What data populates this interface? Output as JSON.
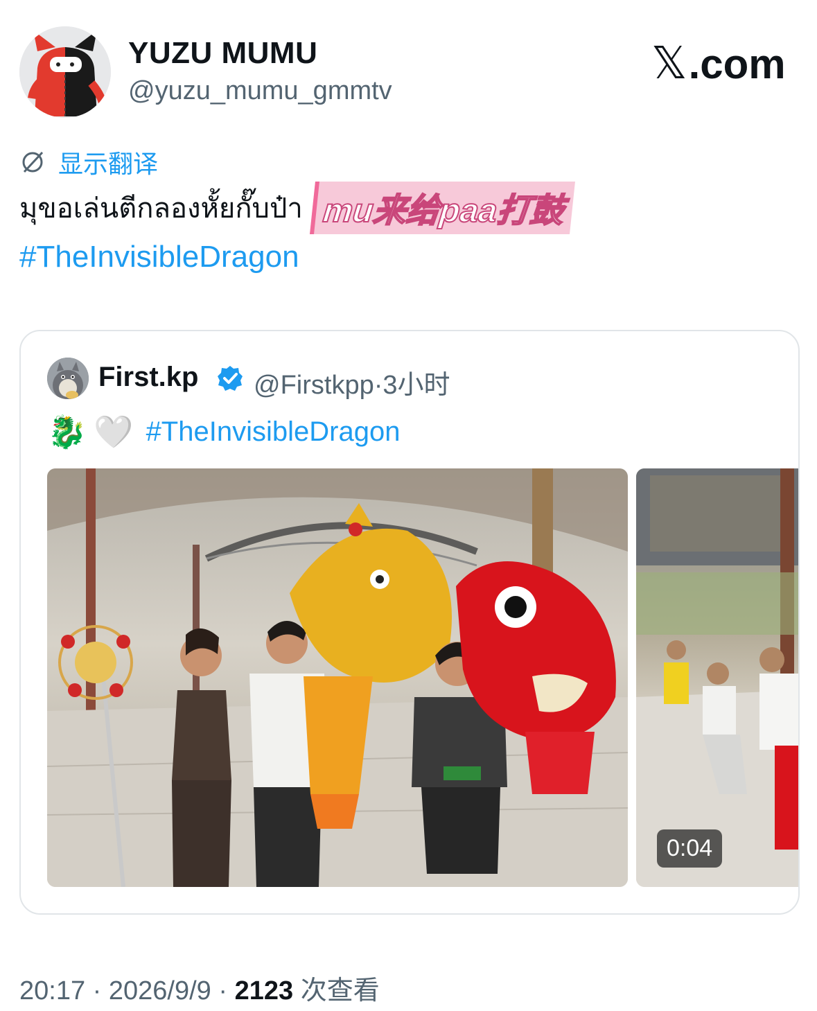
{
  "author": {
    "display_name": "YUZU MUMU",
    "handle": "@yuzu_mumu_gmmtv",
    "avatar_icon": "red-black-cat-plush-avatar"
  },
  "brand": {
    "x_logo": "𝕏",
    "label": ".com"
  },
  "tweet": {
    "translate_label": "显示翻译",
    "text_thai": "มุขอเล่นตีกลองหั้ยกั๊บป๋า",
    "sticker_text": "mu来给paa打鼓",
    "hashtag": "#TheInvisibleDragon"
  },
  "quoted": {
    "display_name": "First.kp",
    "handle": "@Firstkpp",
    "separator": "·",
    "time": "3小时",
    "emoji_dragon": "🐉",
    "emoji_heart": "🤍",
    "hashtag": "#TheInvisibleDragon",
    "video_duration": "0:04"
  },
  "meta": {
    "time": "20:17",
    "sep1": "·",
    "date": "2026/9/9",
    "sep2": "·",
    "views_count": "2123",
    "views_label": "次查看"
  },
  "colors": {
    "link": "#1d9bf0",
    "secondary": "#536471",
    "text": "#0f1419"
  }
}
